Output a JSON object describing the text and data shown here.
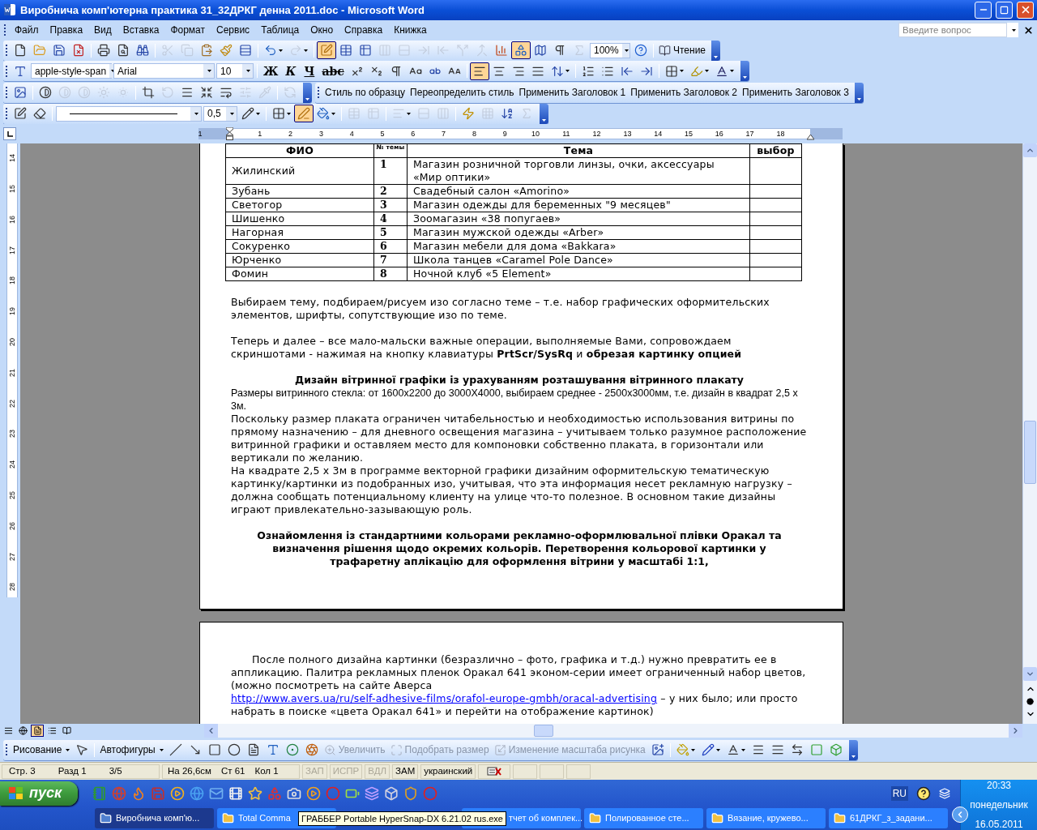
{
  "window": {
    "title": "Виробнича комп'ютерна практика 31_32ДРКГ денна 2011.doc - Microsoft Word"
  },
  "menu": [
    "Файл",
    "Правка",
    "Вид",
    "Вставка",
    "Формат",
    "Сервис",
    "Таблица",
    "Окно",
    "Справка",
    "Книжка"
  ],
  "question_box": {
    "placeholder": "Введите вопрос"
  },
  "standard_toolbar": {
    "items": [
      {
        "kind": "icon",
        "pressed": false,
        "disabled": false
      },
      {
        "kind": "icon",
        "pressed": false,
        "disabled": false
      },
      {
        "kind": "icon",
        "pressed": false,
        "disabled": false
      },
      {
        "kind": "icon",
        "pressed": false,
        "disabled": false
      },
      {
        "kind": "separator"
      },
      {
        "kind": "icon",
        "pressed": false,
        "disabled": false
      },
      {
        "kind": "icon",
        "pressed": false,
        "disabled": false
      },
      {
        "kind": "icon",
        "pressed": false,
        "disabled": false
      },
      {
        "kind": "separator"
      },
      {
        "kind": "icon",
        "pressed": false,
        "disabled": true
      },
      {
        "kind": "icon",
        "pressed": false,
        "disabled": true
      },
      {
        "kind": "icon",
        "pressed": false,
        "disabled": false
      },
      {
        "kind": "icon",
        "pressed": false,
        "disabled": false
      },
      {
        "kind": "icon",
        "pressed": false,
        "disabled": false
      },
      {
        "kind": "separator"
      },
      {
        "kind": "icon",
        "pressed": false,
        "disabled": false,
        "dropdown": true
      },
      {
        "kind": "icon",
        "pressed": false,
        "disabled": true,
        "dropdown": true
      },
      {
        "kind": "separator"
      },
      {
        "kind": "icon",
        "pressed": true,
        "disabled": false
      },
      {
        "kind": "icon",
        "pressed": false,
        "disabled": false
      },
      {
        "kind": "icon",
        "pressed": false,
        "disabled": false
      },
      {
        "kind": "icon",
        "pressed": false,
        "disabled": true
      },
      {
        "kind": "icon",
        "pressed": false,
        "disabled": true
      },
      {
        "kind": "icon",
        "pressed": false,
        "disabled": true
      },
      {
        "kind": "icon",
        "pressed": false,
        "disabled": true
      },
      {
        "kind": "icon",
        "pressed": false,
        "disabled": true
      },
      {
        "kind": "icon",
        "pressed": false,
        "disabled": true
      },
      {
        "kind": "icon",
        "pressed": false,
        "disabled": false
      },
      {
        "kind": "icon",
        "pressed": true,
        "disabled": false
      },
      {
        "kind": "icon",
        "pressed": false,
        "disabled": false
      },
      {
        "kind": "icon",
        "pressed": false,
        "disabled": false
      },
      {
        "kind": "icon",
        "pressed": false,
        "disabled": true
      },
      {
        "kind": "combo",
        "value": "100%"
      },
      {
        "kind": "icon",
        "pressed": false,
        "disabled": false
      },
      {
        "kind": "separator"
      },
      {
        "kind": "text",
        "label": "Чтение",
        "with_icon": true,
        "disabled": false
      }
    ]
  },
  "formatting_toolbar": {
    "items": [
      {
        "kind": "icon",
        "pressed": false,
        "disabled": false
      },
      {
        "kind": "combo",
        "value": "apple-style-span"
      },
      {
        "kind": "combo",
        "value": "Arial"
      },
      {
        "kind": "combo",
        "value": "10"
      },
      {
        "kind": "separator"
      },
      {
        "kind": "letter",
        "label": "Ж",
        "pressed": false
      },
      {
        "kind": "letter",
        "label": "К",
        "pressed": false
      },
      {
        "kind": "letter",
        "label": "Ч",
        "pressed": false
      },
      {
        "kind": "letter",
        "label": "abc",
        "pressed": false
      },
      {
        "kind": "icon",
        "pressed": false,
        "disabled": false
      },
      {
        "kind": "icon",
        "pressed": false,
        "disabled": false
      },
      {
        "kind": "icon",
        "pressed": false,
        "disabled": false
      },
      {
        "kind": "icon",
        "pressed": false,
        "disabled": false
      },
      {
        "kind": "icon",
        "pressed": false,
        "disabled": false
      },
      {
        "kind": "icon",
        "pressed": false,
        "disabled": false
      },
      {
        "kind": "separator"
      },
      {
        "kind": "icon",
        "pressed": true,
        "disabled": false
      },
      {
        "kind": "icon",
        "pressed": false,
        "disabled": false
      },
      {
        "kind": "icon",
        "pressed": false,
        "disabled": false
      },
      {
        "kind": "icon",
        "pressed": false,
        "disabled": false
      },
      {
        "kind": "icon",
        "pressed": false,
        "disabled": false,
        "dropdown": true
      },
      {
        "kind": "separator"
      },
      {
        "kind": "icon",
        "pressed": false,
        "disabled": false
      },
      {
        "kind": "icon",
        "pressed": false,
        "disabled": false
      },
      {
        "kind": "icon",
        "pressed": false,
        "disabled": false
      },
      {
        "kind": "icon",
        "pressed": false,
        "disabled": false
      },
      {
        "kind": "separator"
      },
      {
        "kind": "icon",
        "pressed": false,
        "disabled": false,
        "dropdown": true
      },
      {
        "kind": "icon",
        "pressed": false,
        "disabled": false,
        "dropdown": true
      },
      {
        "kind": "icon",
        "pressed": false,
        "disabled": false,
        "dropdown": true
      }
    ]
  },
  "picture_toolbar": {
    "items": [
      {
        "kind": "icon",
        "pressed": false,
        "disabled": false
      },
      {
        "kind": "separator"
      },
      {
        "kind": "icon",
        "pressed": false,
        "disabled": false
      },
      {
        "kind": "icon",
        "pressed": false,
        "disabled": true
      },
      {
        "kind": "icon",
        "pressed": false,
        "disabled": true
      },
      {
        "kind": "icon",
        "pressed": false,
        "disabled": true
      },
      {
        "kind": "icon",
        "pressed": false,
        "disabled": true
      },
      {
        "kind": "separator"
      },
      {
        "kind": "icon",
        "pressed": false,
        "disabled": false
      },
      {
        "kind": "icon",
        "pressed": false,
        "disabled": true
      },
      {
        "kind": "icon",
        "pressed": false,
        "disabled": false
      },
      {
        "kind": "icon",
        "pressed": false,
        "disabled": false
      },
      {
        "kind": "icon",
        "pressed": false,
        "disabled": false
      },
      {
        "kind": "icon",
        "pressed": false,
        "disabled": true
      },
      {
        "kind": "icon",
        "pressed": false,
        "disabled": true
      },
      {
        "kind": "separator"
      },
      {
        "kind": "icon",
        "pressed": false,
        "disabled": true
      }
    ]
  },
  "styles_toolbar": {
    "items": [
      {
        "kind": "text",
        "label": "Стиль по образцу",
        "with_icon": false,
        "disabled": false
      },
      {
        "kind": "text",
        "label": "Переопределить стиль",
        "with_icon": false,
        "disabled": false
      },
      {
        "kind": "text",
        "label": "Применить Заголовок 1",
        "with_icon": false,
        "disabled": false
      },
      {
        "kind": "text",
        "label": "Применить Заголовок 2",
        "with_icon": false,
        "disabled": false
      },
      {
        "kind": "text",
        "label": "Применить Заголовок 3",
        "with_icon": false,
        "disabled": false
      }
    ]
  },
  "tables_toolbar": {
    "items": [
      {
        "kind": "icon",
        "pressed": false,
        "disabled": false
      },
      {
        "kind": "icon",
        "pressed": false,
        "disabled": false
      },
      {
        "kind": "separator"
      },
      {
        "kind": "line-combo"
      },
      {
        "kind": "combo",
        "value": "0,5"
      },
      {
        "kind": "icon",
        "pressed": false,
        "disabled": false,
        "dropdown": true
      },
      {
        "kind": "separator"
      },
      {
        "kind": "icon",
        "pressed": false,
        "disabled": false,
        "dropdown": true
      },
      {
        "kind": "icon",
        "pressed": true,
        "disabled": false
      },
      {
        "kind": "icon",
        "pressed": false,
        "disabled": false,
        "dropdown": true
      },
      {
        "kind": "separator"
      },
      {
        "kind": "icon",
        "pressed": false,
        "disabled": true
      },
      {
        "kind": "icon",
        "pressed": false,
        "disabled": true
      },
      {
        "kind": "separator"
      },
      {
        "kind": "icon",
        "pressed": false,
        "disabled": true,
        "dropdown": true
      },
      {
        "kind": "icon",
        "pressed": false,
        "disabled": true
      },
      {
        "kind": "icon",
        "pressed": false,
        "disabled": true
      },
      {
        "kind": "separator"
      },
      {
        "kind": "icon",
        "pressed": false,
        "disabled": false
      },
      {
        "kind": "icon",
        "pressed": false,
        "disabled": true
      },
      {
        "kind": "icon",
        "pressed": false,
        "disabled": false
      },
      {
        "kind": "icon",
        "pressed": false,
        "disabled": true
      }
    ]
  },
  "h_ruler": [
    "1",
    "1",
    "2",
    "3",
    "4",
    "5",
    "6",
    "7",
    "8",
    "9",
    "10",
    "11",
    "12",
    "13",
    "14",
    "15",
    "16",
    "17",
    "18"
  ],
  "v_ruler": [
    "14",
    "15",
    "16",
    "17",
    "18",
    "19",
    "20",
    "21",
    "22",
    "23",
    "24",
    "25",
    "26",
    "27",
    "28"
  ],
  "table": {
    "columns": [
      "ФИО",
      "№ темы",
      "Тема",
      "выбор"
    ],
    "rows": [
      [
        "Жилинский",
        "1",
        "Магазин розничной торговли линзы, очки, аксессуары «Мир оптики»"
      ],
      [
        "Зубань",
        "2",
        "Свадебный салон «Amorino»"
      ],
      [
        "Светогор",
        "3",
        "Магазин одежды для беременных \"9 месяцев\""
      ],
      [
        "Шишенко",
        "4",
        "Зоомагазин «38 попугаев»"
      ],
      [
        "Нагорная",
        "5",
        "Магазин мужской одежды «Arber»"
      ],
      [
        "Сокуренко",
        "6",
        "Магазин мебели для дома «Bakkara»"
      ],
      [
        "Юрченко",
        "7",
        "Школа танцев «Caramel Pole Dance»"
      ],
      [
        "Фомин",
        "8",
        "Ночной клуб «5 Element»"
      ]
    ]
  },
  "page1_blocks": [
    {
      "kind": "para",
      "text": "Выбираем тему, подбираем/рисуем изо согласно теме – т.е. набор графических оформительских элементов, шрифты, сопутствующие изо по теме."
    },
    {
      "kind": "para",
      "text": "Теперь и далее – все мало-мальски важные операции, выполняемые Вами, сопровождаем скриншотами - нажимая на кнопку клавиатуры **PrtScr/SysRq** и **обрезая картинку опцией**"
    },
    {
      "kind": "heading",
      "text": "Дизайн вітринної графіки із урахуванням розташування вітринного плакату"
    },
    {
      "kind": "arial",
      "text": "Размеры витринного стекла:  от 1600х2200 до 3000Х4000, выбираем среднее - 2500х3000мм, т.е. дизайн в квадрат 2,5 х 3м."
    },
    {
      "kind": "para",
      "text": "Поскольку размер плаката ограничен читабельностью и необходимостью использования витрины по прямому назначению – для дневного освещения магазина – учитываем только разумное расположение витринной графики и оставляем место для компоновки собственно плаката, в горизонтали или вертикали по желанию."
    },
    {
      "kind": "para",
      "text": "На квадрате 2,5 х 3м в программе векторной графики дизайним оформительскую тематическую картинку/картинки из подобранных изо, учитывая, что эта информация несет рекламную нагрузку – должна сообщать потенциальному клиенту на улице что-то полезное. В основном такие дизайны играют привлекательно-зазывающую роль."
    },
    {
      "kind": "heading",
      "text": "Ознайомлення із стандартними кольорами рекламно-оформлювальної плівки Оракал та визначення рішення щодо окремих кольорів. Перетворення кольорової картинки у трафаретну аплікацію для оформлення вітрини у масштабі 1:1,"
    }
  ],
  "page2": {
    "before_link": "После полного дизайна картинки (безразлично – фото, графика и т.д.) нужно превратить ее в аппликацию. Палитра рекламных пленок Оракал 641 эконом-серии имеет ограниченный набор цветов, (можно посмотреть на сайте Аверса ",
    "link": "http://www.avers.ua/ru/self-adhesive-films/orafol-europe-gmbh/oracal-advertising",
    "after_link": "  – у них было;  или просто набрать в поиске «цвета Оракал 641» и перейти на отображение картинок)"
  },
  "view_buttons": [
    {
      "selected": false
    },
    {
      "selected": false
    },
    {
      "selected": true
    },
    {
      "selected": false
    },
    {
      "selected": false
    }
  ],
  "drawing_toolbar": {
    "items": [
      {
        "kind": "text",
        "label": "Рисование",
        "dropdown": true,
        "with_icon": false,
        "disabled": false
      },
      {
        "kind": "icon",
        "pressed": false,
        "disabled": false
      },
      {
        "kind": "separator"
      },
      {
        "kind": "text",
        "label": "Автофигуры",
        "dropdown": true,
        "with_icon": false,
        "disabled": false
      },
      {
        "kind": "icon",
        "pressed": false,
        "disabled": false
      },
      {
        "kind": "icon",
        "pressed": false,
        "disabled": false
      },
      {
        "kind": "icon",
        "pressed": false,
        "disabled": false
      },
      {
        "kind": "icon",
        "pressed": false,
        "disabled": false
      },
      {
        "kind": "icon",
        "pressed": false,
        "disabled": false
      },
      {
        "kind": "icon",
        "pressed": false,
        "disabled": false
      },
      {
        "kind": "icon",
        "pressed": false,
        "disabled": false
      },
      {
        "kind": "icon",
        "pressed": false,
        "disabled": false
      },
      {
        "kind": "text",
        "label": "Увеличить",
        "with_icon": true,
        "disabled": true
      },
      {
        "kind": "text",
        "label": "Подобрать размер",
        "with_icon": true,
        "disabled": true
      },
      {
        "kind": "text",
        "label": "Изменение масштаба рисунка",
        "with_icon": true,
        "disabled": true
      },
      {
        "kind": "icon",
        "pressed": false,
        "disabled": false
      },
      {
        "kind": "separator"
      },
      {
        "kind": "icon",
        "pressed": false,
        "disabled": false,
        "dropdown": true
      },
      {
        "kind": "icon",
        "pressed": false,
        "disabled": false,
        "dropdown": true
      },
      {
        "kind": "icon",
        "pressed": false,
        "disabled": false,
        "dropdown": true
      },
      {
        "kind": "icon",
        "pressed": false,
        "disabled": false
      },
      {
        "kind": "icon",
        "pressed": false,
        "disabled": false
      },
      {
        "kind": "icon",
        "pressed": false,
        "disabled": false
      },
      {
        "kind": "icon",
        "pressed": false,
        "disabled": false
      },
      {
        "kind": "icon",
        "pressed": false,
        "disabled": false
      }
    ]
  },
  "status_bar": {
    "position": [
      "Стр. 3",
      "Разд 1",
      "3/5"
    ],
    "cursor": [
      "На 26,6см",
      "Ст 61",
      "Кол 1"
    ],
    "modes": [
      {
        "label": "ЗАП",
        "active": false
      },
      {
        "label": "ИСПР",
        "active": false
      },
      {
        "label": "ВДЛ",
        "active": false
      },
      {
        "label": "ЗАМ",
        "active": true
      }
    ],
    "language": "украинский"
  },
  "taskbar": {
    "start": "пуск",
    "tasks": [
      {
        "label": "Виробнича комп'ю...",
        "selected": true
      },
      {
        "label": "Total Comma",
        "selected": false
      },
      {
        "label": "тчет об комплек...",
        "selected": false
      },
      {
        "label": "Полированное сте...",
        "selected": false
      },
      {
        "label": "Вязание, кружево...",
        "selected": false
      },
      {
        "label": "61ДРКГ_з_задани...",
        "selected": false
      }
    ],
    "tooltip": "ГРАББЕР Portable HyperSnap-DX 6.21.02 rus.exe",
    "language": "RU",
    "time": "20:33",
    "day": "понедельник",
    "date": "16.05.2011"
  }
}
